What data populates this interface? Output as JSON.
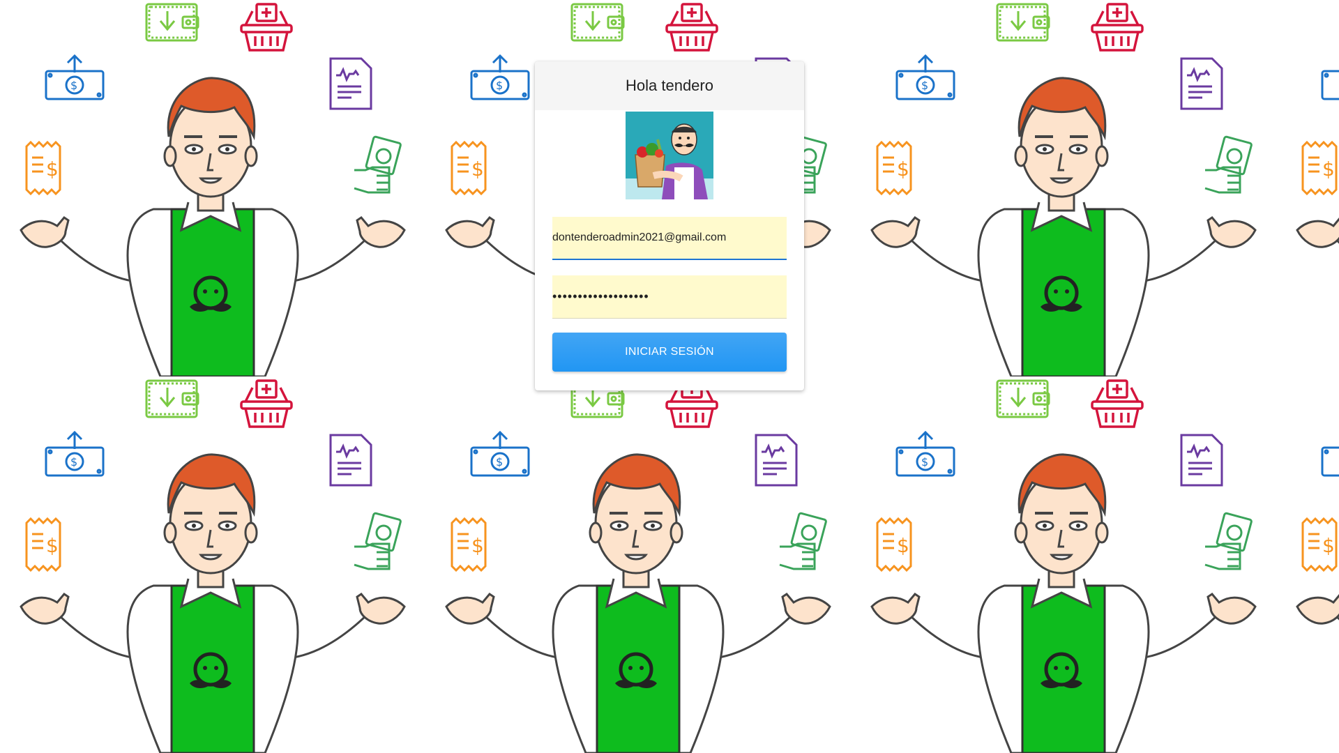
{
  "login": {
    "title": "Hola tendero",
    "email_value": "dontenderoadmin2021@gmail.com",
    "password_value": "•••••••••••••••••••",
    "submit_label": "INICIAR SESIÓN"
  },
  "icons": {
    "wallet": "wallet-download-icon",
    "basket": "shopping-basket-icon",
    "money_up": "money-upload-icon",
    "document": "document-chart-icon",
    "receipt": "receipt-dollar-icon",
    "cash_hand": "hand-cash-icon",
    "shopkeeper": "shopkeeper-illustration",
    "avatar": "grocer-avatar"
  },
  "colors": {
    "accent": "#2196f3",
    "field_bg": "#fffacd",
    "apron": "#0ebc1e",
    "hair": "#de5a2a"
  }
}
